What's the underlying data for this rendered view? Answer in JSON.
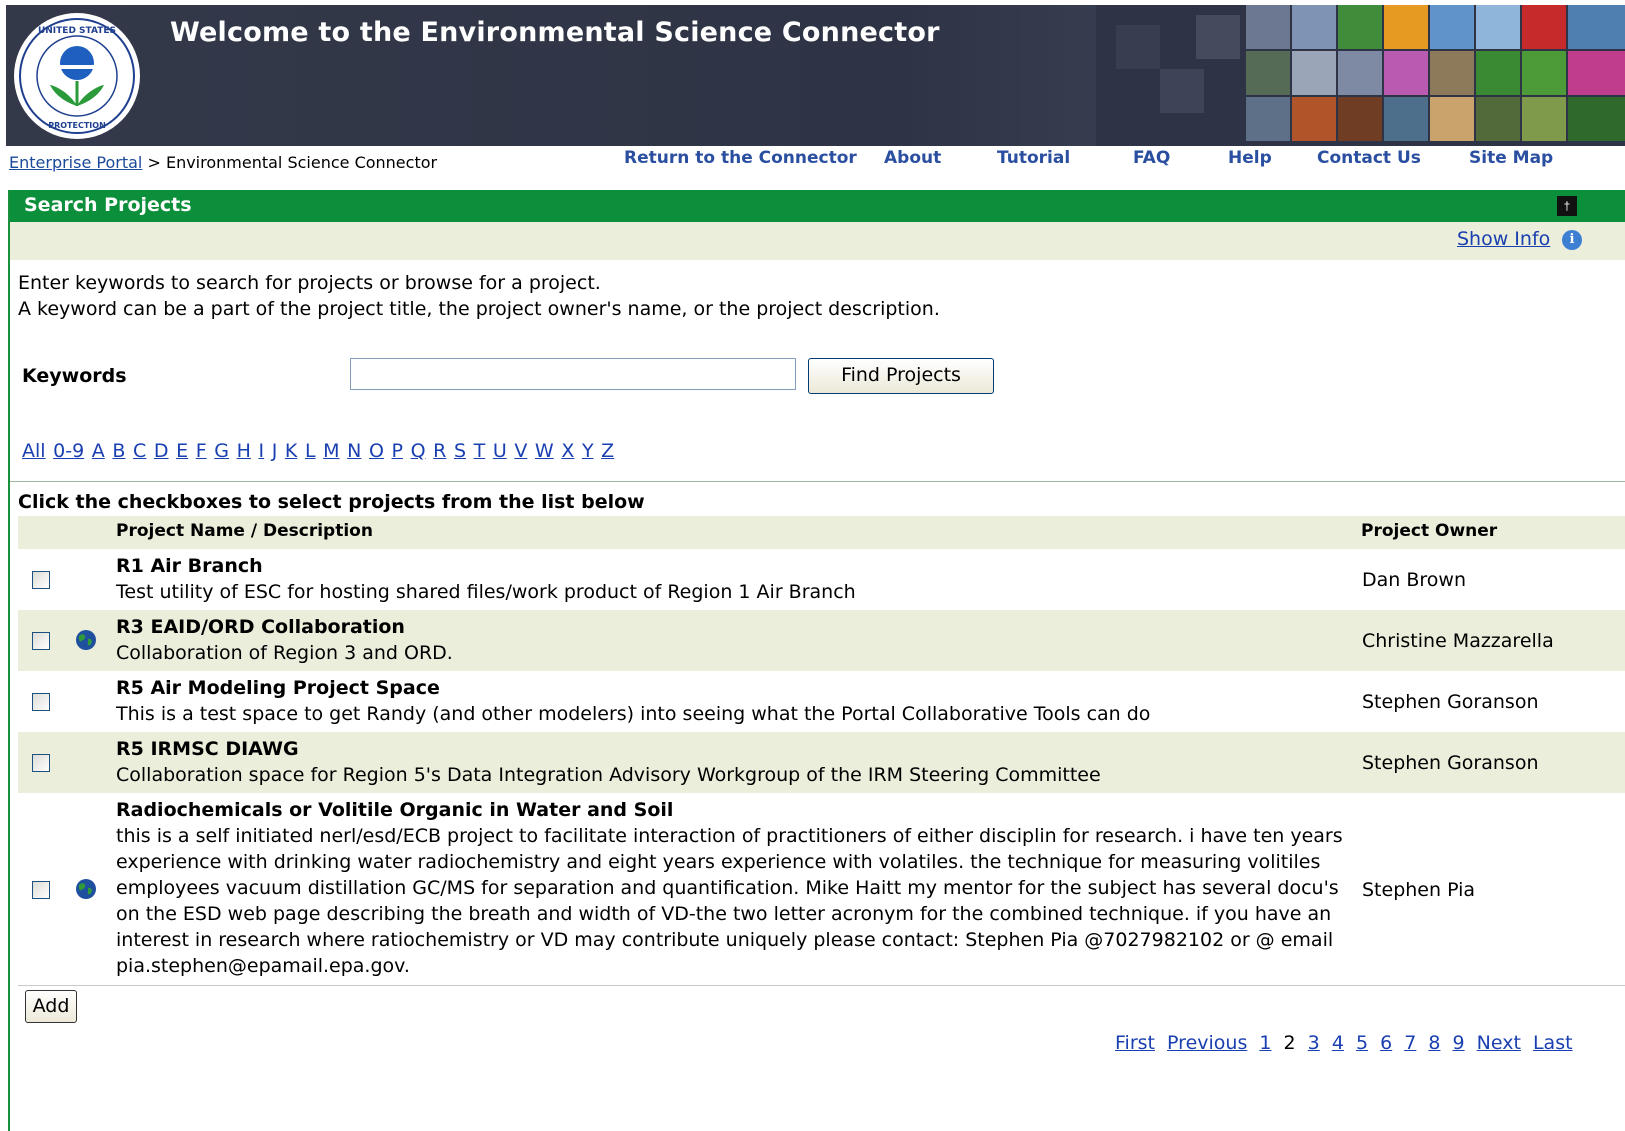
{
  "header": {
    "title": "Welcome to the Environmental Science Connector",
    "seal_text": "UNITED STATES ENVIRONMENTAL PROTECTION AGENCY"
  },
  "breadcrumb": {
    "link": "Enterprise Portal",
    "separator": ">",
    "current": "Environmental Science Connector"
  },
  "nav": [
    {
      "label": "Return to the Connector"
    },
    {
      "label": "About"
    },
    {
      "label": "Tutorial"
    },
    {
      "label": "FAQ"
    },
    {
      "label": "Help"
    },
    {
      "label": "Contact Us"
    },
    {
      "label": "Site Map"
    }
  ],
  "panel": {
    "title": "Search Projects",
    "show_info": "Show Info",
    "collapse_icon": "pin-icon"
  },
  "intro": {
    "line1": "Enter keywords to search for projects or browse for a project.",
    "line2": "A keyword can be a part of the project title, the project owner's name, or the project description."
  },
  "search": {
    "label": "Keywords",
    "value": "",
    "button": "Find Projects"
  },
  "alphabet": [
    "All",
    "0-9",
    "A",
    "B",
    "C",
    "D",
    "E",
    "F",
    "G",
    "H",
    "I",
    "J",
    "K",
    "L",
    "M",
    "N",
    "O",
    "P",
    "Q",
    "R",
    "S",
    "T",
    "U",
    "V",
    "W",
    "X",
    "Y",
    "Z"
  ],
  "list": {
    "caption": "Click the checkboxes to select projects from the list below",
    "col_name": "Project Name / Description",
    "col_owner": "Project Owner",
    "rows": [
      {
        "name": "R1 Air Branch",
        "desc": "Test utility of ESC for hosting shared files/work product of Region 1 Air Branch",
        "owner": "Dan Brown",
        "public": false
      },
      {
        "name": "R3 EAID/ORD Collaboration",
        "desc": "Collaboration of Region 3 and ORD.",
        "owner": "Christine Mazzarella",
        "public": true
      },
      {
        "name": "R5 Air Modeling Project Space",
        "desc": "This is a test space to get Randy (and other modelers) into seeing what the Portal Collaborative Tools can do",
        "owner": "Stephen Goranson",
        "public": false
      },
      {
        "name": "R5 IRMSC DIAWG",
        "desc": "Collaboration space for Region 5's Data Integration Advisory Workgroup of the IRM Steering Committee",
        "owner": "Stephen Goranson",
        "public": false
      },
      {
        "name": "Radiochemicals or Volitile Organic in Water and Soil",
        "desc": "this is a self initiated nerl/esd/ECB project to facilitate interaction of practitioners of either disciplin for research. i have ten years experience with drinking water radiochemistry and eight years experience with volatiles. the technique for measuring volitiles employees vacuum distillation GC/MS for separation and quantification. Mike Haitt my mentor for the subject has several docu's on the ESD web page describing the breath and width of VD-the two letter acronym for the combined technique. if you have an interest in research where ratiochemistry or VD may contribute uniquely please contact: Stephen Pia @7027982102 or @ email pia.stephen@epamail.epa.gov.",
        "owner": "Stephen Pia",
        "public": true
      }
    ],
    "add_button": "Add"
  },
  "pager": {
    "first": "First",
    "previous": "Previous",
    "pages": [
      "1",
      "2",
      "3",
      "4",
      "5",
      "6",
      "7",
      "8",
      "9"
    ],
    "current": "2",
    "next": "Next",
    "last": "Last"
  },
  "colors": {
    "banner": "#2e3445",
    "panel_header": "#0b8f3a",
    "row_shade": "#eaeedb",
    "link": "#1a3fb0"
  }
}
